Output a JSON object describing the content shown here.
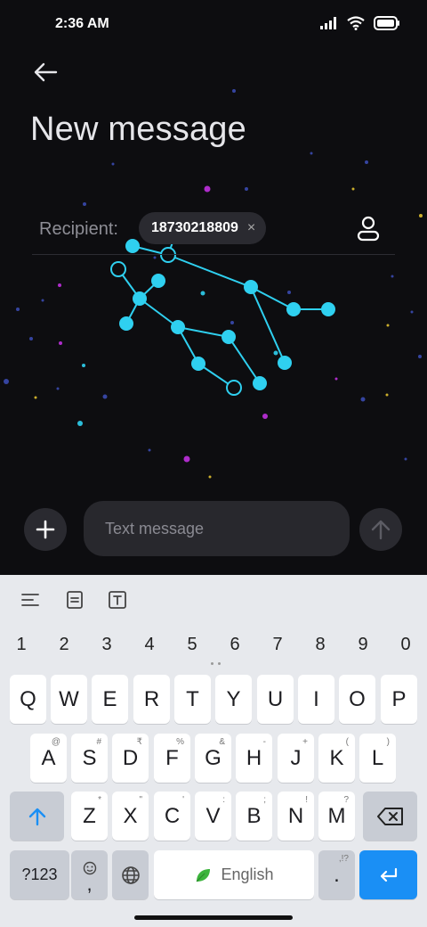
{
  "status_bar": {
    "time": "2:36 AM"
  },
  "header": {
    "title": "New message"
  },
  "recipient": {
    "label": "Recipient:",
    "chip_value": "18730218809",
    "chip_remove": "×"
  },
  "compose": {
    "placeholder": "Text message"
  },
  "keyboard": {
    "numbers": [
      "1",
      "2",
      "3",
      "4",
      "5",
      "6",
      "7",
      "8",
      "9",
      "0"
    ],
    "row1": [
      {
        "k": "Q",
        "h": ""
      },
      {
        "k": "W",
        "h": ""
      },
      {
        "k": "E",
        "h": ""
      },
      {
        "k": "R",
        "h": ""
      },
      {
        "k": "T",
        "h": ""
      },
      {
        "k": "Y",
        "h": ""
      },
      {
        "k": "U",
        "h": ""
      },
      {
        "k": "I",
        "h": ""
      },
      {
        "k": "O",
        "h": ""
      },
      {
        "k": "P",
        "h": ""
      }
    ],
    "row2": [
      {
        "k": "A",
        "h": "@"
      },
      {
        "k": "S",
        "h": "#"
      },
      {
        "k": "D",
        "h": "₹"
      },
      {
        "k": "F",
        "h": "%"
      },
      {
        "k": "G",
        "h": "&"
      },
      {
        "k": "H",
        "h": "-"
      },
      {
        "k": "J",
        "h": "+"
      },
      {
        "k": "K",
        "h": "("
      },
      {
        "k": "L",
        "h": ")"
      }
    ],
    "row3": [
      {
        "k": "Z",
        "h": "*"
      },
      {
        "k": "X",
        "h": "\""
      },
      {
        "k": "C",
        "h": "'"
      },
      {
        "k": "V",
        "h": ":"
      },
      {
        "k": "B",
        "h": ";"
      },
      {
        "k": "N",
        "h": "!"
      },
      {
        "k": "M",
        "h": "?"
      }
    ],
    "symbols_label": "?123",
    "comma_label": ",",
    "space_label": "English",
    "period_label": ".",
    "period_hint": ",!?"
  },
  "colors": {
    "background": "#0d0d10",
    "constellation": "#2fd0f0",
    "accent_blue": "#1a8ff5",
    "keyboard_bg": "#e7e9ed"
  },
  "icons": {
    "back": "arrow-left-icon",
    "contact": "person-icon",
    "add": "plus-icon",
    "send": "arrow-up-icon",
    "shift": "shift-arrow-icon",
    "backspace": "backspace-icon",
    "emoji": "emoji-icon",
    "globe": "globe-icon",
    "enter": "enter-icon",
    "leaf": "leaf-icon"
  }
}
